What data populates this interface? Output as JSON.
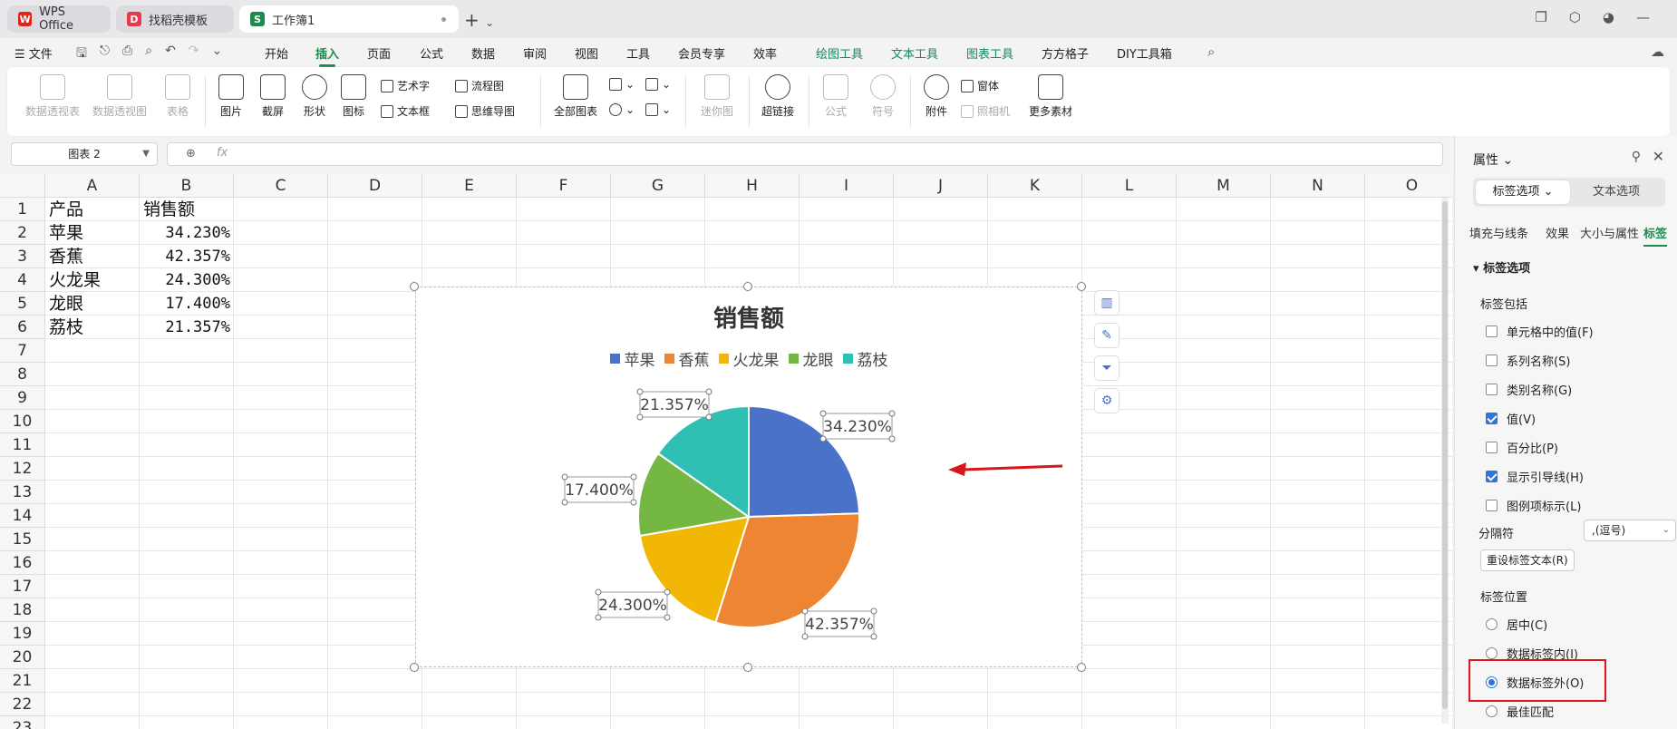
{
  "tabs": {
    "wps": "WPS Office",
    "template": "找稻壳模板",
    "workbook": "工作簿1"
  },
  "menu": {
    "file": "☰ 文件",
    "items": [
      "开始",
      "插入",
      "页面",
      "公式",
      "数据",
      "审阅",
      "视图",
      "工具",
      "会员专享",
      "效率",
      "绘图工具",
      "文本工具",
      "图表工具",
      "方方格子",
      "DIY工具箱"
    ],
    "active": "插入"
  },
  "ribbon": {
    "pivot_table": "数据透视表",
    "pivot_chart": "数据透视图",
    "table": "表格",
    "picture": "图片",
    "screenshot": "截屏",
    "shape": "形状",
    "icon": "图标",
    "wordart": "艺术字",
    "textbox": "文本框",
    "flowchart": "流程图",
    "mindmap": "思维导图",
    "all_charts": "全部图表",
    "sparkline": "迷你图",
    "hyperlink": "超链接",
    "formula": "公式",
    "symbol": "符号",
    "attachment": "附件",
    "window": "窗体",
    "camera": "照相机",
    "more": "更多素材"
  },
  "formula_bar": {
    "name_box": "图表 2",
    "fx": "fx",
    "content": ""
  },
  "sheet": {
    "columns": [
      "A",
      "B",
      "C",
      "D",
      "E",
      "F",
      "G",
      "H",
      "I",
      "J",
      "K",
      "L",
      "M",
      "N",
      "O"
    ],
    "rows": [
      "1",
      "2",
      "3",
      "4",
      "5",
      "6",
      "7",
      "8",
      "9",
      "10",
      "11",
      "12",
      "13",
      "14",
      "15",
      "16",
      "17",
      "18",
      "19",
      "20",
      "21",
      "22",
      "23"
    ],
    "header": [
      "产品",
      "销售额"
    ],
    "data": [
      [
        "苹果",
        "34.230%"
      ],
      [
        "香蕉",
        "42.357%"
      ],
      [
        "火龙果",
        "24.300%"
      ],
      [
        "龙眼",
        "17.400%"
      ],
      [
        "荔枝",
        "21.357%"
      ]
    ]
  },
  "chart_data": {
    "type": "pie",
    "title": "销售额",
    "categories": [
      "苹果",
      "香蕉",
      "火龙果",
      "龙眼",
      "荔枝"
    ],
    "values": [
      34.23,
      42.357,
      24.3,
      17.4,
      21.357
    ],
    "labels": [
      "34.230%",
      "42.357%",
      "24.300%",
      "17.400%",
      "21.357%"
    ],
    "colors": [
      "#4a72c8",
      "#ee8532",
      "#f2b705",
      "#74b843",
      "#2fbfb3"
    ],
    "legend_position": "top",
    "data_label_position": "outside_end"
  },
  "panel": {
    "title": "属性",
    "tab_label_options": "标签选项",
    "tab_text_options": "文本选项",
    "subtabs": [
      "填充与线条",
      "效果",
      "大小与属性",
      "标签"
    ],
    "section": "标签选项",
    "label_contains": "标签包括",
    "checkboxes": [
      {
        "label": "单元格中的值(F)",
        "checked": false
      },
      {
        "label": "系列名称(S)",
        "checked": false
      },
      {
        "label": "类别名称(G)",
        "checked": false
      },
      {
        "label": "值(V)",
        "checked": true
      },
      {
        "label": "百分比(P)",
        "checked": false
      },
      {
        "label": "显示引导线(H)",
        "checked": true
      },
      {
        "label": "图例项标示(L)",
        "checked": false
      }
    ],
    "separator_label": "分隔符",
    "separator_value": ",(逗号)",
    "reset_button": "重设标签文本(R)",
    "position_label": "标签位置",
    "radios": [
      {
        "label": "居中(C)",
        "selected": false
      },
      {
        "label": "数据标签内(I)",
        "selected": false
      },
      {
        "label": "数据标签外(O)",
        "selected": true
      },
      {
        "label": "最佳匹配",
        "selected": false
      }
    ]
  },
  "annotation": {
    "arrow_color": "#d9151b",
    "highlight_color": "#e0161c"
  }
}
